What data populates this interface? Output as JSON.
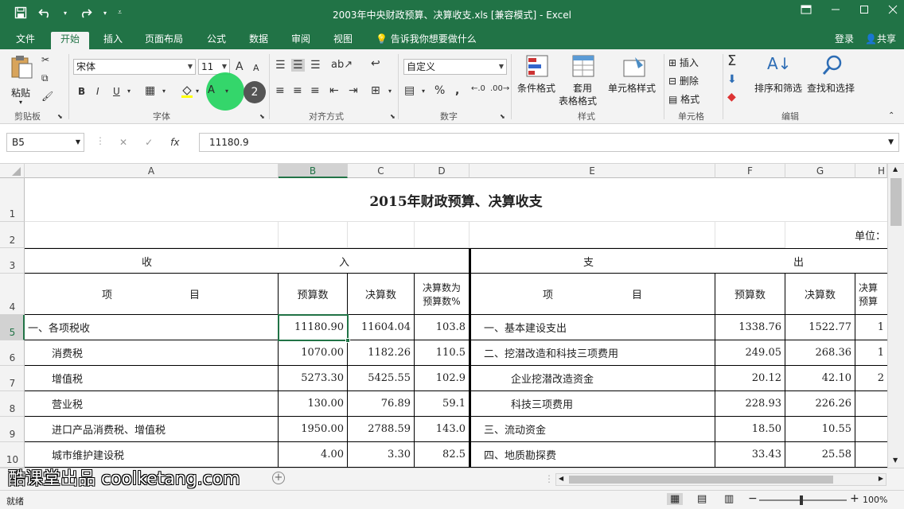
{
  "window": {
    "title": "2003年中央财政预算、决算收支.xls  [兼容模式] - Excel"
  },
  "tabs": [
    "文件",
    "开始",
    "插入",
    "页面布局",
    "公式",
    "数据",
    "审阅",
    "视图"
  ],
  "active_tab": "开始",
  "tell_me": "告诉我你想要做什么",
  "account": {
    "login": "登录",
    "share": "共享"
  },
  "ribbon": {
    "clipboard": {
      "paste": "粘贴",
      "label": "剪贴板"
    },
    "font": {
      "name": "宋体",
      "size": "11",
      "bold": "B",
      "italic": "I",
      "underline": "U",
      "label": "字体",
      "grow": "A",
      "shrink": "A",
      "color_letter": "A"
    },
    "alignment": {
      "label": "对齐方式"
    },
    "number": {
      "format": "自定义",
      "percent": "%",
      "comma": ",",
      "label": "数字"
    },
    "styles": {
      "cond_format": "条件格式",
      "table_format_1": "套用",
      "table_format_2": "表格格式",
      "cell_style": "单元格样式",
      "label": "样式"
    },
    "cells": {
      "insert": "插入",
      "delete": "删除",
      "format": "格式",
      "label": "单元格"
    },
    "editing": {
      "sort": "排序和筛选",
      "find": "查找和选择",
      "label": "编辑"
    }
  },
  "formula_bar": {
    "name_box": "B5",
    "cancel": "✕",
    "enter": "✓",
    "fx": "fx",
    "value": "11180.9"
  },
  "columns": [
    "A",
    "B",
    "C",
    "D",
    "E",
    "F",
    "G",
    "H"
  ],
  "rows": [
    "1",
    "2",
    "3",
    "4",
    "5",
    "6",
    "7",
    "8",
    "9",
    "10"
  ],
  "sheet": {
    "title": "2015年财政预算、决算收支",
    "unit": "单位：",
    "income_header_left": "收",
    "income_header_right": "入",
    "expense_header_left": "支",
    "expense_header_right": "出",
    "item_header_left": "项",
    "item_header_right": "目",
    "budget": "预算数",
    "final": "决算数",
    "ratio_1": "决算数为",
    "ratio_2": "预算数%",
    "ratio_short": "决算",
    "ratio_short_2": "预算",
    "income_rows": [
      {
        "name": "一、各项税收",
        "budget": "11180.90",
        "final": "11604.04",
        "ratio": "103.8"
      },
      {
        "name": "消费税",
        "budget": "1070.00",
        "final": "1182.26",
        "ratio": "110.5"
      },
      {
        "name": "增值税",
        "budget": "5273.30",
        "final": "5425.55",
        "ratio": "102.9"
      },
      {
        "name": "营业税",
        "budget": "130.00",
        "final": "76.89",
        "ratio": "59.1"
      },
      {
        "name": "进口产品消费税、增值税",
        "budget": "1950.00",
        "final": "2788.59",
        "ratio": "143.0"
      },
      {
        "name": "城市维护建设税",
        "budget": "4.00",
        "final": "3.30",
        "ratio": "82.5"
      }
    ],
    "expense_rows": [
      {
        "name": "一、基本建设支出",
        "budget": "1338.76",
        "final": "1522.77",
        "ratio": "1"
      },
      {
        "name": "二、挖潜改造和科技三项费用",
        "budget": "249.05",
        "final": "268.36",
        "ratio": "1"
      },
      {
        "name": "企业挖潜改造资金",
        "budget": "20.12",
        "final": "42.10",
        "ratio": "2"
      },
      {
        "name": "科技三项费用",
        "budget": "228.93",
        "final": "226.26",
        "ratio": ""
      },
      {
        "name": "三、流动资金",
        "budget": "18.50",
        "final": "10.55",
        "ratio": ""
      },
      {
        "name": "四、地质勘探费",
        "budget": "33.43",
        "final": "25.58",
        "ratio": ""
      }
    ]
  },
  "status": {
    "ready": "就绪",
    "zoom": "100%"
  },
  "watermark": "酷课堂出品 coolketang.com",
  "cursor_badge": "2",
  "colors": {
    "brand": "#217346",
    "selection": "#217346"
  }
}
